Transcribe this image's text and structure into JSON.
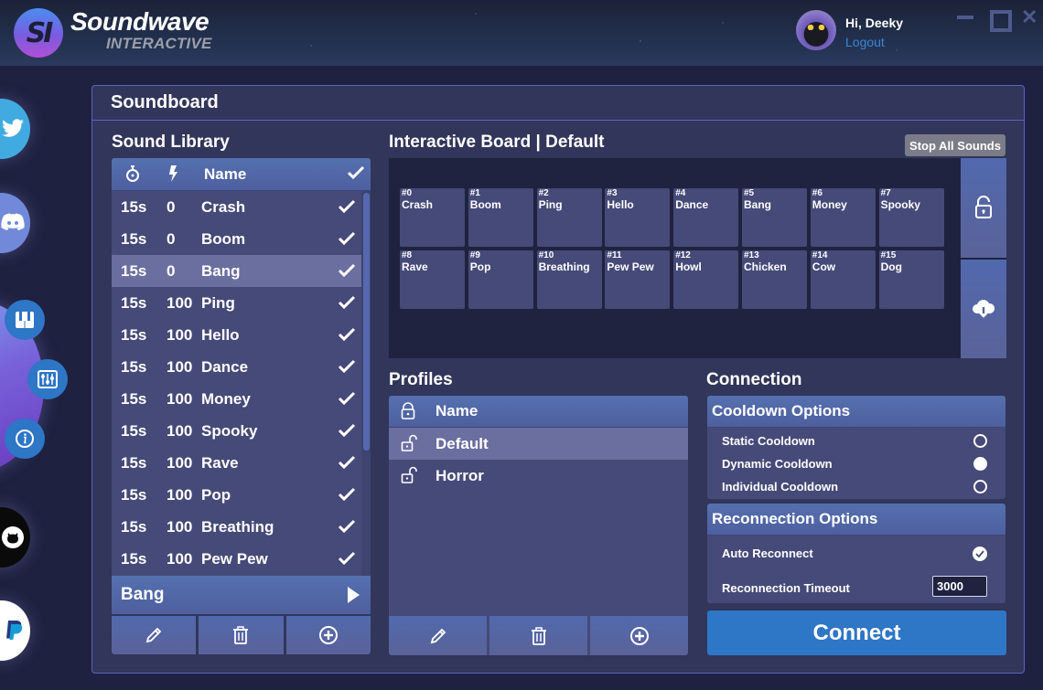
{
  "app": {
    "logo_badge": "SI",
    "logo_title": "Soundwave",
    "logo_subtitle": "INTERACTIVE"
  },
  "user": {
    "greeting": "Hi, Deeky",
    "logout_label": "Logout"
  },
  "window_controls": {
    "close_glyph": "✕"
  },
  "sidebar": {
    "items": [
      {
        "name": "twitter",
        "icon": "twitter-icon",
        "color": "#41abe1"
      },
      {
        "name": "discord",
        "icon": "discord-icon",
        "color": "#7289da"
      },
      {
        "name": "soundboard",
        "icon": "piano-icon",
        "color": "#2e76c6"
      },
      {
        "name": "settings",
        "icon": "mixer-icon",
        "color": "#2e76c6"
      },
      {
        "name": "info",
        "icon": "info-icon",
        "color": "#2e76c6"
      },
      {
        "name": "github",
        "icon": "github-icon",
        "color": "#0a0a0a"
      },
      {
        "name": "paypal",
        "icon": "paypal-icon",
        "color": "#ffffff"
      }
    ]
  },
  "window": {
    "title": "Soundboard"
  },
  "sound_library": {
    "title": "Sound Library",
    "columns": {
      "cooldown_icon": "stopwatch-icon",
      "energy_icon": "bolt-icon",
      "name": "Name",
      "enabled_icon": "check-icon"
    },
    "rows": [
      {
        "cooldown": "15s",
        "cost": "0",
        "name": "Crash",
        "enabled": true
      },
      {
        "cooldown": "15s",
        "cost": "0",
        "name": "Boom",
        "enabled": true
      },
      {
        "cooldown": "15s",
        "cost": "0",
        "name": "Bang",
        "enabled": true,
        "selected": true
      },
      {
        "cooldown": "15s",
        "cost": "100",
        "name": "Ping",
        "enabled": true
      },
      {
        "cooldown": "15s",
        "cost": "100",
        "name": "Hello",
        "enabled": true
      },
      {
        "cooldown": "15s",
        "cost": "100",
        "name": "Dance",
        "enabled": true
      },
      {
        "cooldown": "15s",
        "cost": "100",
        "name": "Money",
        "enabled": true
      },
      {
        "cooldown": "15s",
        "cost": "100",
        "name": "Spooky",
        "enabled": true
      },
      {
        "cooldown": "15s",
        "cost": "100",
        "name": "Rave",
        "enabled": true
      },
      {
        "cooldown": "15s",
        "cost": "100",
        "name": "Pop",
        "enabled": true
      },
      {
        "cooldown": "15s",
        "cost": "100",
        "name": "Breathing",
        "enabled": true
      },
      {
        "cooldown": "15s",
        "cost": "100",
        "name": "Pew Pew",
        "enabled": true
      }
    ],
    "selected_sound": "Bang",
    "actions": [
      "edit",
      "delete",
      "add"
    ]
  },
  "board": {
    "title": "Interactive Board | Default",
    "stop_all_label": "Stop All Sounds",
    "pads": [
      {
        "num": "#0",
        "label": "Crash"
      },
      {
        "num": "#1",
        "label": "Boom"
      },
      {
        "num": "#2",
        "label": "Ping"
      },
      {
        "num": "#3",
        "label": "Hello"
      },
      {
        "num": "#4",
        "label": "Dance"
      },
      {
        "num": "#5",
        "label": "Bang"
      },
      {
        "num": "#6",
        "label": "Money"
      },
      {
        "num": "#7",
        "label": "Spooky"
      },
      {
        "num": "#8",
        "label": "Rave"
      },
      {
        "num": "#9",
        "label": "Pop"
      },
      {
        "num": "#10",
        "label": "Breathing"
      },
      {
        "num": "#11",
        "label": "Pew Pew"
      },
      {
        "num": "#12",
        "label": "Howl"
      },
      {
        "num": "#13",
        "label": "Chicken"
      },
      {
        "num": "#14",
        "label": "Cow"
      },
      {
        "num": "#15",
        "label": "Dog"
      }
    ],
    "side_buttons": [
      "lock-icon",
      "cloud-download-icon"
    ]
  },
  "profiles": {
    "title": "Profiles",
    "column_name": "Name",
    "rows": [
      {
        "name": "Default",
        "locked": false,
        "selected": true
      },
      {
        "name": "Horror",
        "locked": false
      }
    ]
  },
  "connection": {
    "title": "Connection",
    "cooldown": {
      "title": "Cooldown Options",
      "options": [
        {
          "label": "Static Cooldown",
          "selected": false
        },
        {
          "label": "Dynamic Cooldown",
          "selected": true
        },
        {
          "label": "Individual Cooldown",
          "selected": false
        }
      ]
    },
    "reconnection": {
      "title": "Reconnection Options",
      "auto_reconnect_label": "Auto Reconnect",
      "auto_reconnect": true,
      "timeout_label": "Reconnection Timeout",
      "timeout_value": "3000"
    },
    "connect_label": "Connect",
    "accent": "#2e76c6"
  }
}
